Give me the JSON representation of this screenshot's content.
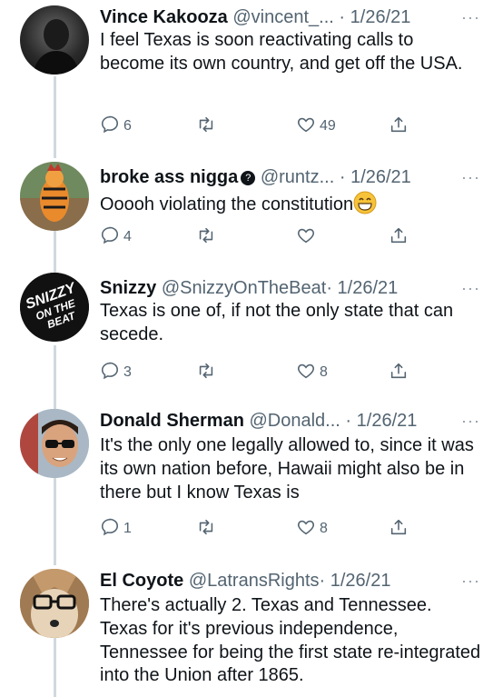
{
  "tweets": [
    {
      "name": "Vince Kakooza",
      "handle": "@vincent_...",
      "dot": "·",
      "date": "1/26/21",
      "text": "I feel Texas is soon reactivating calls to become its own country, and get off the USA.",
      "replies": "6",
      "retweets": "",
      "likes": "49"
    },
    {
      "name": "broke ass nigga",
      "badge_icon": "question-badge-icon",
      "handle": "@runtz...",
      "dot": "·",
      "date": "1/26/21",
      "text": "Ooooh violating the constitution",
      "emoji": "grinning-face-emoji",
      "replies": "4",
      "retweets": "",
      "likes": ""
    },
    {
      "name": "Snizzy",
      "handle": "@SnizzyOnTheBeat",
      "dot": "·",
      "date": "1/26/21",
      "text": "Texas is one of, if not the only state that can secede.",
      "avatar_text": "SNIZZY ON THE BEAT",
      "replies": "3",
      "retweets": "",
      "likes": "8"
    },
    {
      "name": "Donald Sherman",
      "handle": "@Donald...",
      "dot": "·",
      "date": "1/26/21",
      "text": "It's the only one legally allowed to, since it was its own nation before, Hawaii might also be in there but I know Texas is",
      "replies": "1",
      "retweets": "",
      "likes": "8"
    },
    {
      "name": "El Coyote",
      "handle": "@LatransRights",
      "dot": "·",
      "date": "1/26/21",
      "text": "There's actually 2. Texas and Tennessee. Texas for it's previous independence, Tennessee for being the first state re-integrated into the Union after 1865."
    }
  ],
  "more_label": "···",
  "icons": {
    "reply": "reply-icon",
    "retweet": "retweet-icon",
    "like": "heart-icon",
    "share": "share-icon"
  },
  "colors": {
    "text": "#0f1419",
    "secondary": "#536471",
    "thread_line": "#cfd9de"
  }
}
